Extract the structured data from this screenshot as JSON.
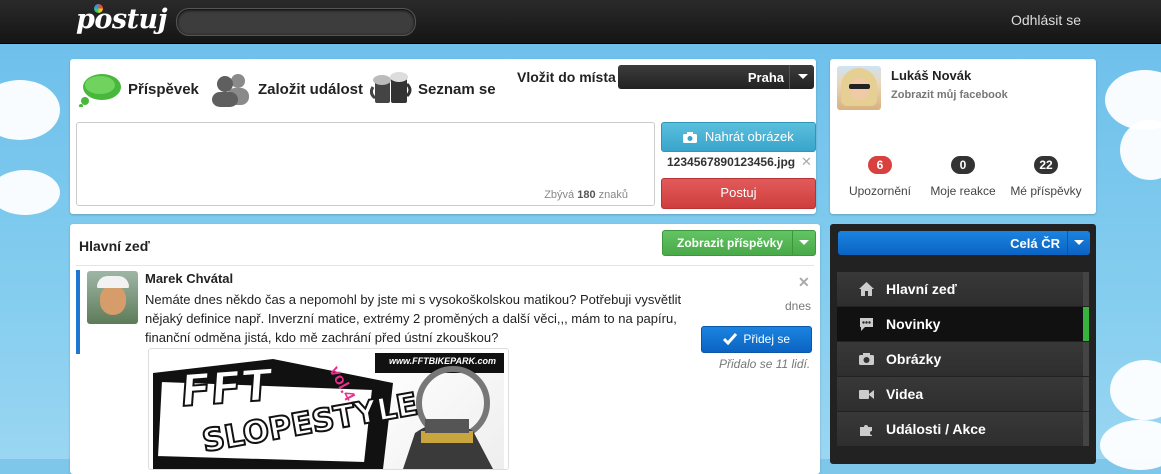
{
  "topbar": {
    "logo": "postuj",
    "search_placeholder": "",
    "logout_label": "Odhlásit se"
  },
  "composer": {
    "tabs": [
      {
        "label": "Příspěvek",
        "icon": "speech-bubble-icon"
      },
      {
        "label": "Založit událost",
        "icon": "people-icon"
      },
      {
        "label": "Seznam se",
        "icon": "beer-mugs-icon"
      }
    ],
    "place_label": "Vložit do místa",
    "place_value": "Praha",
    "textarea_value": "",
    "remaining_prefix": "Zbývá",
    "remaining_count": "180",
    "remaining_suffix": "znaků",
    "upload_label": "Nahrát obrázek",
    "file_name": "1234567890123456.jpg",
    "post_label": "Postuj"
  },
  "profile": {
    "name": "Lukáš Novák",
    "facebook_link": "Zobrazit můj facebook",
    "stats": [
      {
        "count": "6",
        "label": "Upozornění",
        "color": "#d9413e"
      },
      {
        "count": "0",
        "label": "Moje reakce",
        "color": "#333333"
      },
      {
        "count": "22",
        "label": "Mé příspěvky",
        "color": "#333333"
      }
    ]
  },
  "wall": {
    "title": "Hlavní zeď",
    "show_posts_label": "Zobrazit příspěvky",
    "post": {
      "author": "Marek Chvátal",
      "text": "Nemáte dnes někdo čas a nepomohl by jste mi s vysokoškolskou matikou? Potřebuji vysvětlit nějaký definice např. Inverzní matice, extrémy 2 proměných a další věci,,, mám to na papíru, finanční odměna jistá, kdo mě zachrání před ústní zkouškou?",
      "date": "dnes",
      "join_label": "Přidej se",
      "joined_text": "Přidalo se 11 lidí.",
      "poster_site": "www.FFTBIKEPARK.com",
      "poster_title_1": "FFT",
      "poster_title_2": "SLOPESTYLE",
      "poster_vol": "vol.4"
    }
  },
  "nav": {
    "region": "Celá ČR",
    "items": [
      {
        "label": "Hlavní zeď",
        "icon": "home-icon",
        "active": false
      },
      {
        "label": "Novinky",
        "icon": "chat-icon",
        "active": true
      },
      {
        "label": "Obrázky",
        "icon": "camera-icon",
        "active": false
      },
      {
        "label": "Videa",
        "icon": "video-camera-icon",
        "active": false
      },
      {
        "label": "Události / Akce",
        "icon": "puzzle-icon",
        "active": false
      }
    ]
  },
  "colors": {
    "accent_blue": "#0b63c2",
    "success_green": "#4aa94a",
    "danger_red": "#cf3e3e",
    "info_cyan": "#39a4cb"
  }
}
